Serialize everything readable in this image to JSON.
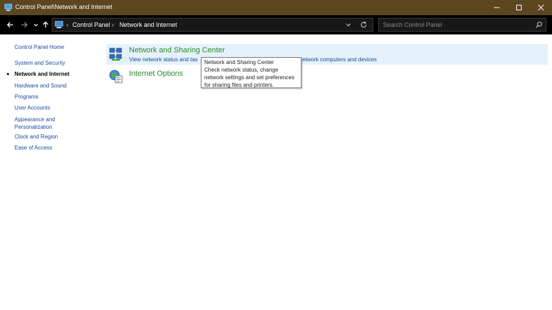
{
  "window": {
    "title": "Control Panel\\Network and Internet",
    "titlebar_color": "#5b4620"
  },
  "address": {
    "crumbs": [
      "Control Panel",
      "Network and Internet"
    ]
  },
  "search": {
    "placeholder": "Search Control Panel",
    "value": ""
  },
  "sidebar": {
    "items": [
      {
        "label": "Control Panel Home"
      },
      {
        "label": "System and Security"
      },
      {
        "label": "Network and Internet",
        "current": true
      },
      {
        "label": "Hardware and Sound"
      },
      {
        "label": "Programs"
      },
      {
        "label": "User Accounts"
      },
      {
        "label": "Appearance and",
        "label2": "Personalization"
      },
      {
        "label": "Clock and Region"
      },
      {
        "label": "Ease of Access"
      }
    ]
  },
  "main": {
    "categories": [
      {
        "title": "Network and Sharing Center",
        "icon": "network-sharing-icon",
        "sublinks": [
          "View network status and tas",
          "etwork computers and devices"
        ]
      },
      {
        "title": "Internet Options",
        "icon": "internet-options-icon"
      }
    ]
  },
  "tooltip": {
    "lines": [
      "Network and Sharing Center",
      "Check network status, change",
      "network settings and set preferences",
      "for sharing files and printers."
    ]
  },
  "colors": {
    "link": "#1a4a9a",
    "category_title": "#2b8a2b",
    "hover_bg": "#e6f2fb"
  }
}
